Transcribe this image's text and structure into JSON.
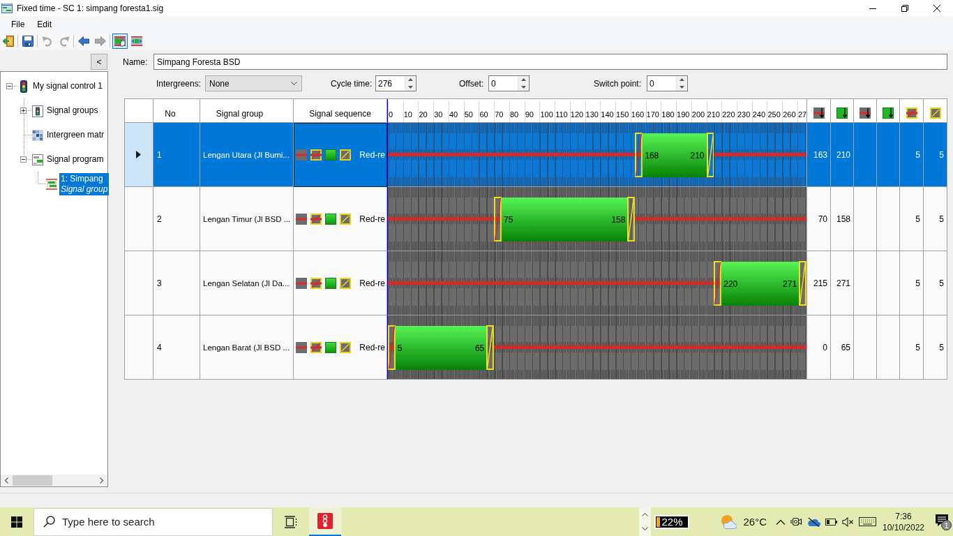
{
  "window": {
    "title": "Fixed time - SC 1: simpang foresta1.sig"
  },
  "menu": [
    "File",
    "Edit"
  ],
  "toolbar_groups": [
    {
      "buttons": [
        {
          "kind": "open",
          "disabled": false
        }
      ]
    },
    {
      "buttons": [
        {
          "kind": "save",
          "disabled": false
        }
      ]
    },
    {
      "buttons": [
        {
          "kind": "undo",
          "disabled": true
        },
        {
          "kind": "redo",
          "disabled": true
        }
      ]
    },
    {
      "buttons": [
        {
          "kind": "back",
          "disabled": false
        },
        {
          "kind": "forward",
          "disabled": true
        }
      ]
    },
    {
      "buttons": [
        {
          "kind": "chart_view",
          "selected": true
        },
        {
          "kind": "intergreen_view",
          "selected": false
        }
      ]
    }
  ],
  "collapse_button": "<",
  "tree": [
    {
      "kind": "controller",
      "label": "My signal control 1",
      "expanded": true,
      "selected": false,
      "children": [
        {
          "kind": "signal_groups",
          "label": "Signal groups",
          "expanded": false,
          "selected": false
        },
        {
          "kind": "intergreen_matrix",
          "label": "Intergreen matr",
          "selected": false
        },
        {
          "kind": "signal_program",
          "label": "Signal program",
          "expanded": true,
          "selected": false,
          "children": [
            {
              "kind": "program_item",
              "label": "1: Simpang",
              "sublabel": "Signal group",
              "selected": true
            }
          ]
        }
      ]
    }
  ],
  "name_field": {
    "label": "Name:",
    "value": "Simpang Foresta BSD"
  },
  "intergreens": {
    "label": "Intergreens:",
    "value": "None"
  },
  "cycle_time": {
    "label": "Cycle time:",
    "value": "276"
  },
  "offset": {
    "label": "Offset:",
    "value": "0"
  },
  "switch_point": {
    "label": "Switch point:",
    "value": "0"
  },
  "table": {
    "columns": [
      "No",
      "Signal group",
      "Signal sequence"
    ],
    "timeline_ticks": [
      "0",
      "10",
      "20",
      "30",
      "40",
      "50",
      "60",
      "70",
      "80",
      "90",
      "100",
      "110",
      "120",
      "130",
      "140",
      "150",
      "160",
      "170",
      "180",
      "190",
      "200",
      "210",
      "220",
      "230",
      "240",
      "250",
      "260",
      "27"
    ],
    "rows": [
      {
        "selected": true,
        "no": "1",
        "signal_group": "Lengan Utara (Jl Bumi...",
        "sequence": "Red-re",
        "green_start": "168",
        "green_end": "210",
        "red_end": "163",
        "green_end_time": "210",
        "red_amber_time": "5",
        "amber_time": "5"
      },
      {
        "selected": false,
        "no": "2",
        "signal_group": "Lengan Timur (Jl BSD ...",
        "sequence": "Red-re",
        "green_start": "75",
        "green_end": "158",
        "red_end": "70",
        "green_end_time": "158",
        "red_amber_time": "5",
        "amber_time": "5"
      },
      {
        "selected": false,
        "no": "3",
        "signal_group": "Lengan Selatan (Jl Da...",
        "sequence": "Red-re",
        "green_start": "220",
        "green_end": "271",
        "red_end": "215",
        "green_end_time": "271",
        "red_amber_time": "5",
        "amber_time": "5"
      },
      {
        "selected": false,
        "no": "4",
        "signal_group": "Lengan Barat (Jl BSD ...",
        "sequence": "Red-re",
        "green_start": "5",
        "green_end": "65",
        "red_end": "0",
        "green_end_time": "65",
        "red_amber_time": "5",
        "amber_time": "5"
      }
    ]
  },
  "taskbar": {
    "search_placeholder": "Type here to search",
    "apps": [
      {
        "kind": "signal_app",
        "active": true
      }
    ],
    "battery_widget": "22%",
    "temperature": "26°C",
    "time": "7:36",
    "date": "10/10/2022",
    "notification_count": "1"
  }
}
